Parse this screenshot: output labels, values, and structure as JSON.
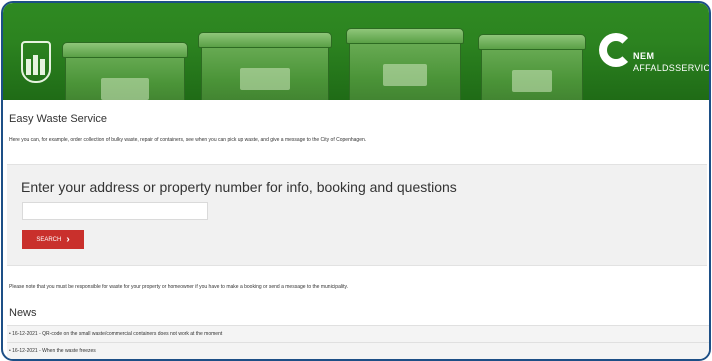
{
  "hero": {
    "crest_icon": "copenhagen-crest-icon",
    "logo": {
      "icon": "nem-affald-logo-icon",
      "line1": "NEM",
      "line2": "AFFALDSSERVICE"
    },
    "colors": {
      "banner": "#2c8320",
      "bins": "#4b9438"
    }
  },
  "page": {
    "title": "Easy Waste Service",
    "intro": "Here you can, for example, order collection of bulky waste, repair of containers, see when you can pick up waste, and give a message to the City of Copenhagen."
  },
  "search": {
    "heading": "Enter your address or property number for info, booking and questions",
    "input_value": "",
    "input_placeholder": "",
    "button_label": "SEARCH",
    "button_icon": "chevron-right-icon",
    "button_color": "#c9302c"
  },
  "notice": "Please note that you must be responsible for waste for your property or homeowner if you have to make a booking or send a message to the municipality.",
  "news": {
    "heading": "News",
    "items": [
      {
        "text": "• 16-12-2021 - QR-code on the small waste/commercial containers does not work at the moment"
      },
      {
        "text": "• 16-12-2021 - When the waste freezes"
      }
    ]
  }
}
